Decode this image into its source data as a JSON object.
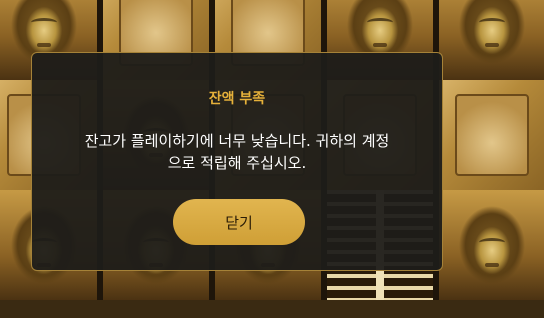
{
  "dialog": {
    "title": "잔액 부족",
    "message_line1": "잔고가 플레이하기에 너무 낮습니다. 귀하의 계정",
    "message_line2": "으로 적립해 주십시오.",
    "close_label": "닫기"
  },
  "colors": {
    "title": "#e6b13a",
    "button": "#d9ab45",
    "dialog_bg": "#1e1c19",
    "dialog_border": "#a58238"
  }
}
